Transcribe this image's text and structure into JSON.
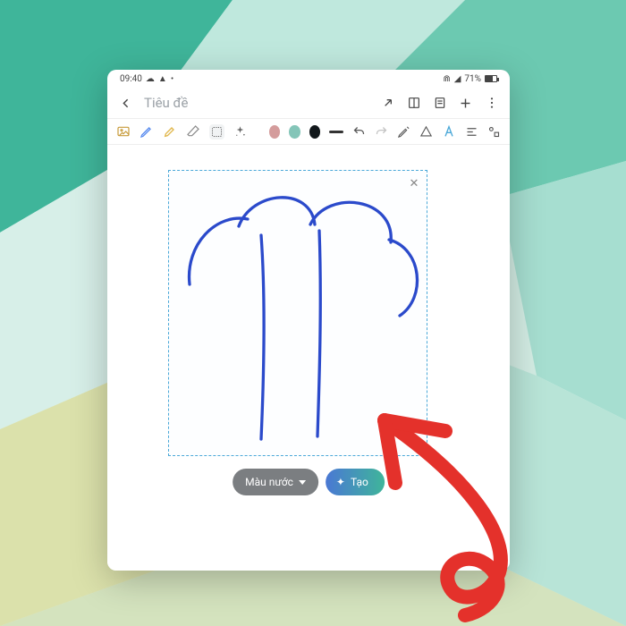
{
  "statusbar": {
    "time": "09:40",
    "battery": "71%"
  },
  "header": {
    "title": "Tiêu đề"
  },
  "toolbar": {
    "colors": {
      "c1": "#d49c9c",
      "c2": "#84c5b8",
      "c3": "#12181b"
    }
  },
  "actions": {
    "style_label": "Màu nước",
    "create_label": "Tạo"
  },
  "selection": {
    "close": "✕"
  }
}
